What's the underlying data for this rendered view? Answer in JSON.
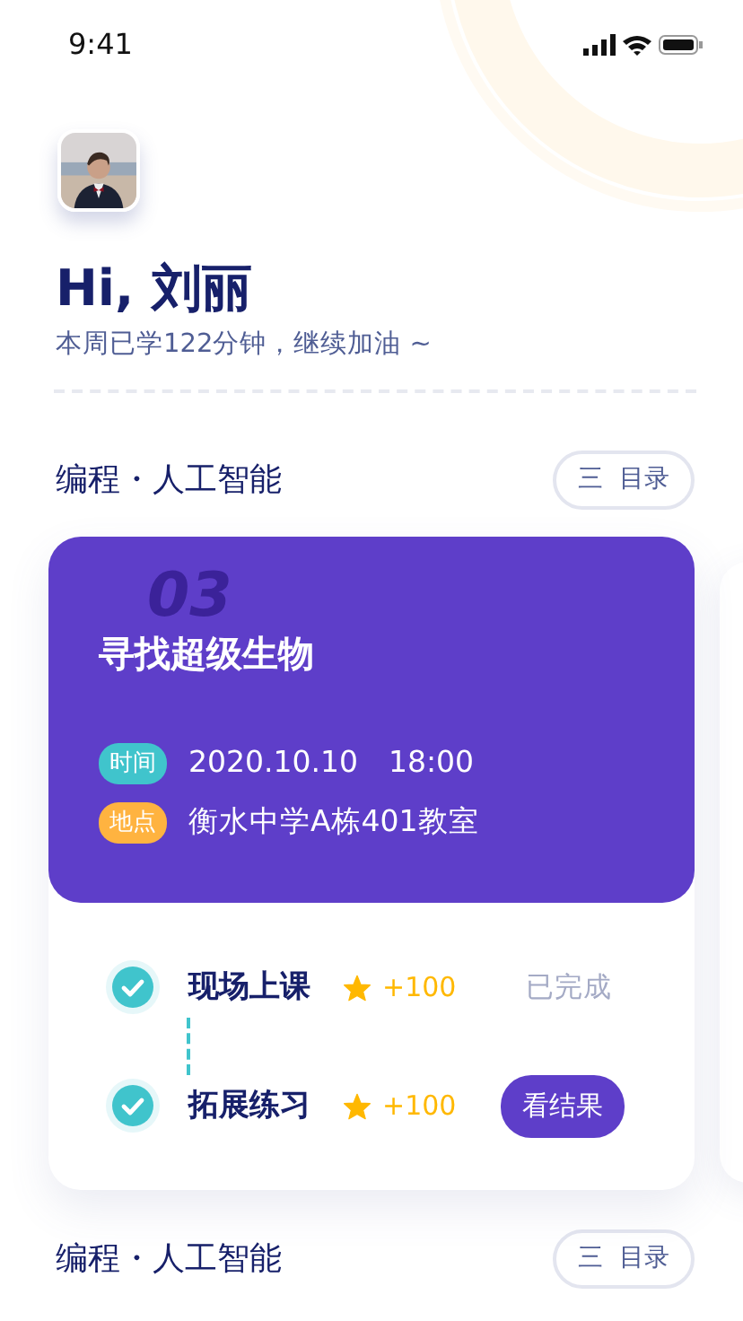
{
  "status_bar": {
    "time": "9:41"
  },
  "greeting": {
    "title": "Hi, 刘丽",
    "subtitle": "本周已学122分钟，继续加油 ~"
  },
  "sections": [
    {
      "title": "编程・人工智能",
      "menu_button": {
        "icon": "三",
        "label": "目录"
      },
      "lesson": {
        "number": "03",
        "title": "寻找超级生物",
        "info": [
          {
            "tag": "时间",
            "color": "#40c4cc",
            "value": "2020.10.10　18:00"
          },
          {
            "tag": "地点",
            "color": "#ffb340",
            "value": "衡水中学A栋401教室"
          }
        ],
        "tasks": [
          {
            "name": "现场上课",
            "done": true,
            "points": "+100",
            "kind": "status",
            "action": "已完成"
          },
          {
            "name": "拓展练习",
            "done": true,
            "points": "+100",
            "kind": "button",
            "action": "看结果"
          }
        ]
      }
    },
    {
      "title": "编程・人工智能",
      "menu_button": {
        "icon": "三",
        "label": "目录"
      }
    }
  ]
}
